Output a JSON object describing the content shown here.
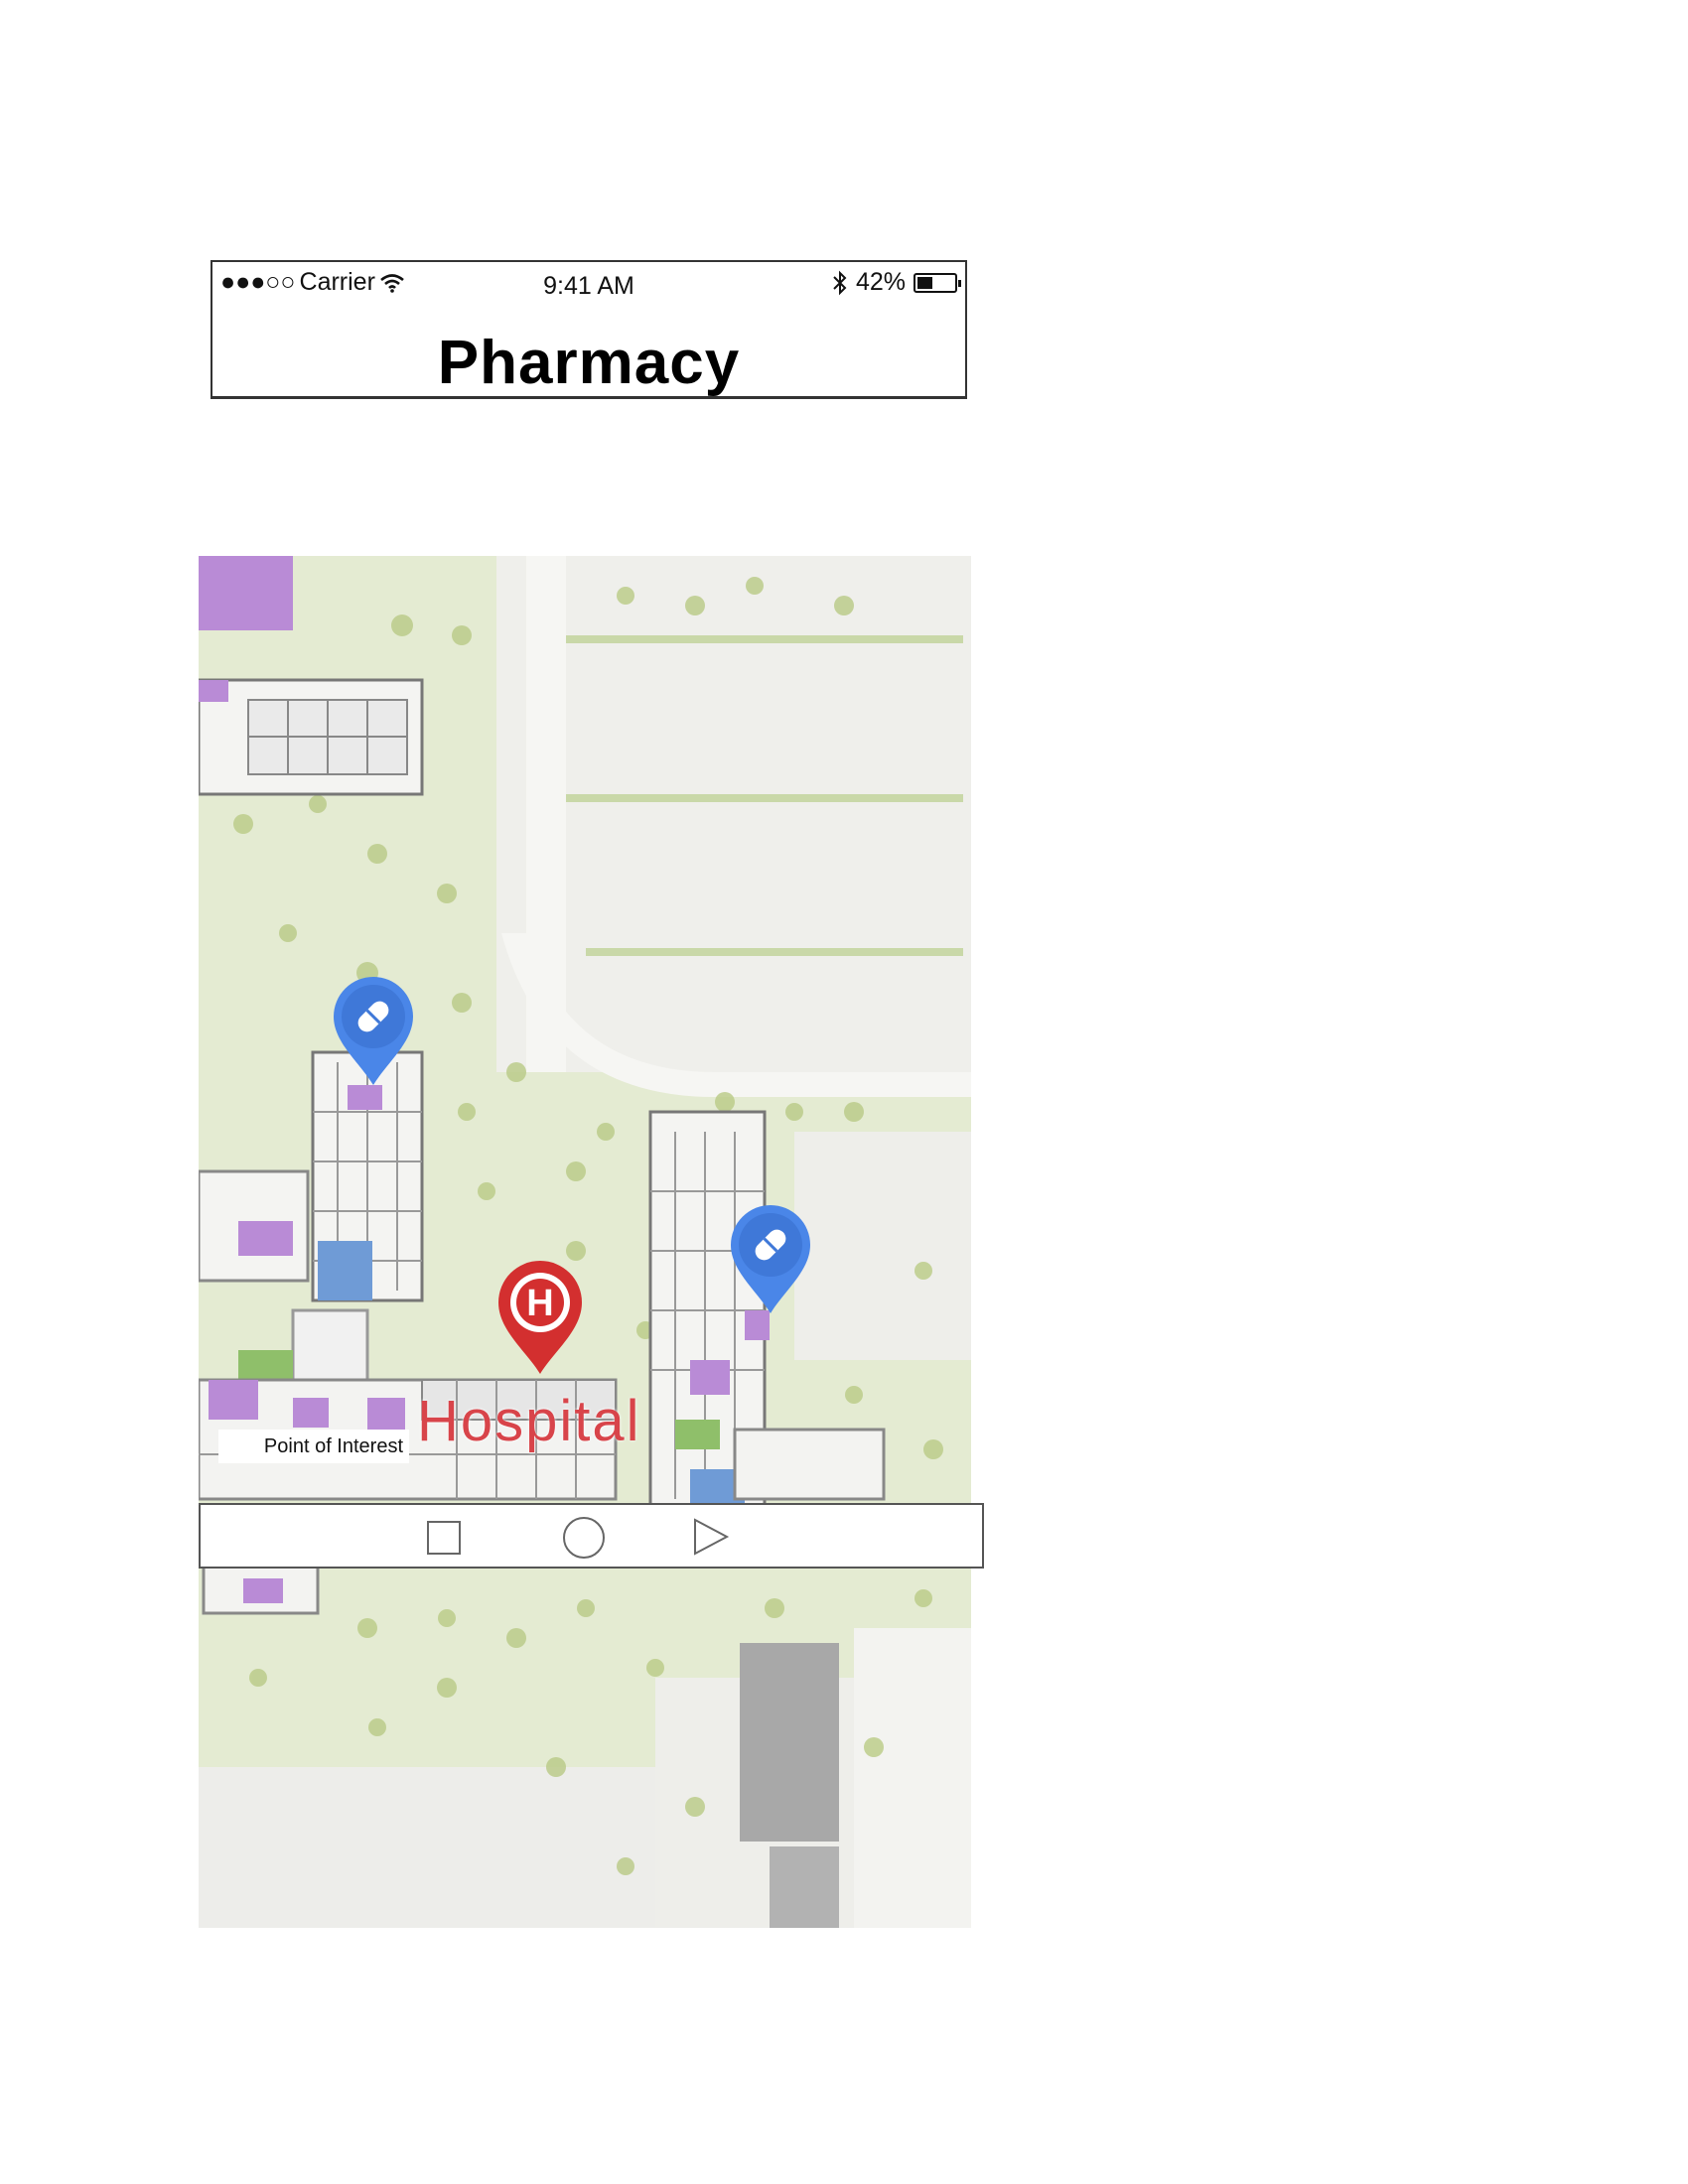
{
  "status_bar": {
    "signal": "●●●○○",
    "carrier": "Carrier",
    "time": "9:41 AM",
    "battery_percent": "42%",
    "battery_level": 0.42,
    "icons": [
      "wifi-icon",
      "bluetooth-icon",
      "battery-icon"
    ]
  },
  "header": {
    "title": "Pharmacy"
  },
  "map": {
    "poi_label": "Point of Interest",
    "hospital_label": "Hospital",
    "hospital_icon_letter": "H",
    "markers": [
      {
        "name": "pharmacy-marker",
        "icon": "pill-icon"
      },
      {
        "name": "pharmacy-marker",
        "icon": "pill-icon"
      },
      {
        "name": "hospital-marker",
        "icon": "hospital-h-icon"
      }
    ],
    "colors": {
      "grass": "#e4ebd2",
      "road": "#f2f2ee",
      "building_outline": "#7a7a7a",
      "building_purple": "#b98bd6",
      "pharmacy_pin": "#4a86e8",
      "hospital_pin": "#d32f2f",
      "hospital_text": "#d8444a"
    }
  },
  "nav_bar": {
    "buttons": [
      "square-icon",
      "circle-icon",
      "triangle-icon"
    ]
  }
}
